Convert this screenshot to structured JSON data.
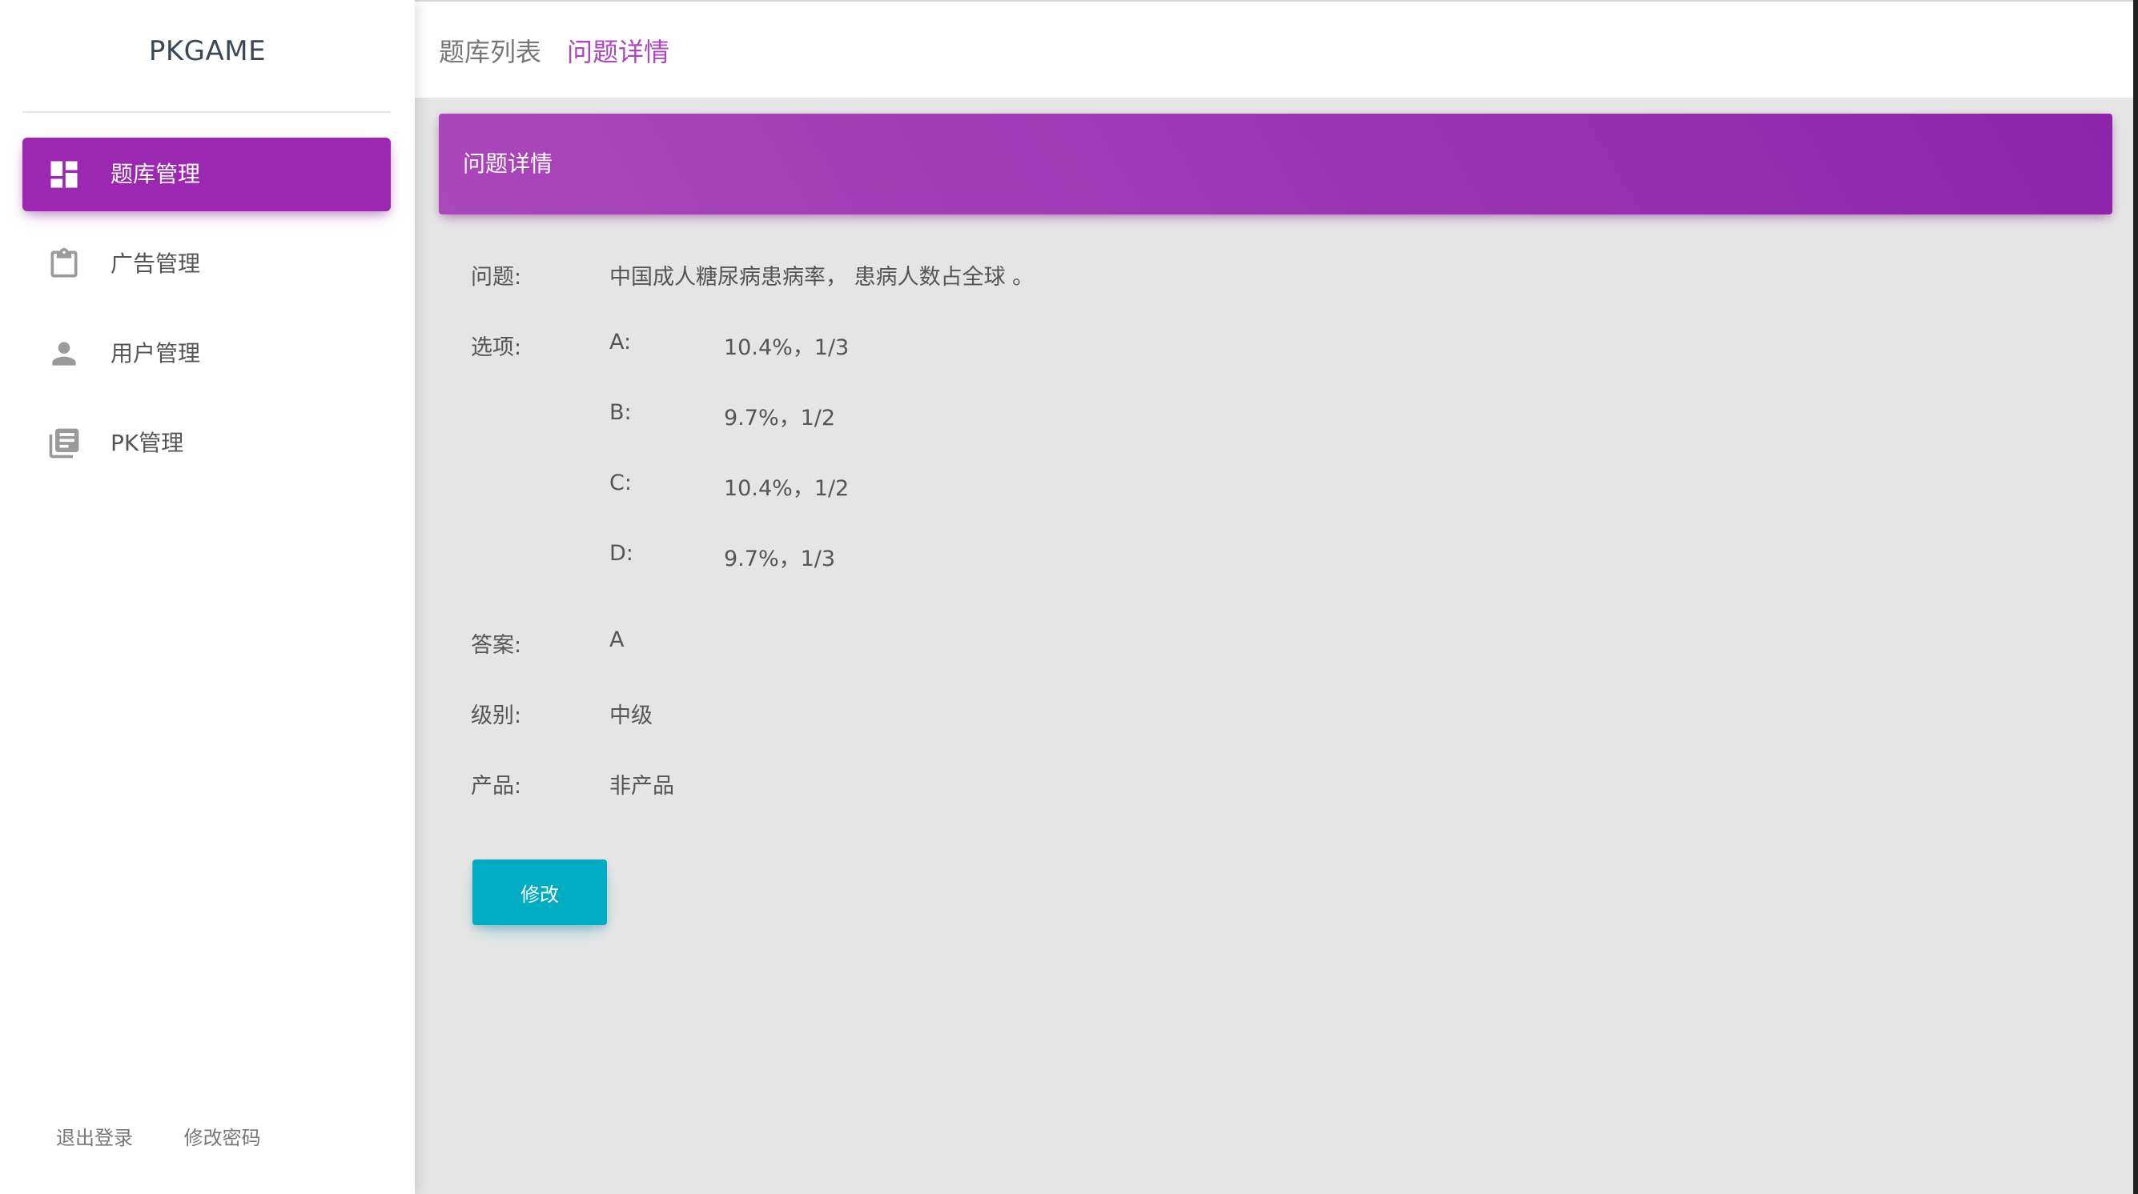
{
  "sidebar": {
    "brand": "PKGAME",
    "items": [
      {
        "label": "题库管理",
        "icon": "dashboard-icon",
        "active": true
      },
      {
        "label": "广告管理",
        "icon": "clipboard-icon",
        "active": false
      },
      {
        "label": "用户管理",
        "icon": "person-icon",
        "active": false
      },
      {
        "label": "PK管理",
        "icon": "library-books-icon",
        "active": false
      }
    ],
    "footer": {
      "logout": "退出登录",
      "change_password": "修改密码"
    }
  },
  "breadcrumb": {
    "list": "题库列表",
    "detail": "问题详情"
  },
  "card": {
    "title": "问题详情"
  },
  "question": {
    "label": "问题:",
    "text": "中国成人糖尿病患病率， 患病人数占全球 。"
  },
  "options": {
    "label": "选项:",
    "items": [
      {
        "letter": "A:",
        "text": "10.4%，1/3"
      },
      {
        "letter": "B:",
        "text": "9.7%，1/2"
      },
      {
        "letter": "C:",
        "text": "10.4%，1/2"
      },
      {
        "letter": "D:",
        "text": "9.7%，1/3"
      }
    ]
  },
  "answer": {
    "label": "答案:",
    "value": "A"
  },
  "level": {
    "label": "级别:",
    "value": "中级"
  },
  "product": {
    "label": "产品:",
    "value": "非产品"
  },
  "actions": {
    "edit": "修改"
  },
  "colors": {
    "accent": "#9c27b0",
    "header_gradient_start": "#ab47bc",
    "header_gradient_end": "#8e24aa",
    "button": "#00acc1",
    "active_crumb": "#ab47bc"
  }
}
